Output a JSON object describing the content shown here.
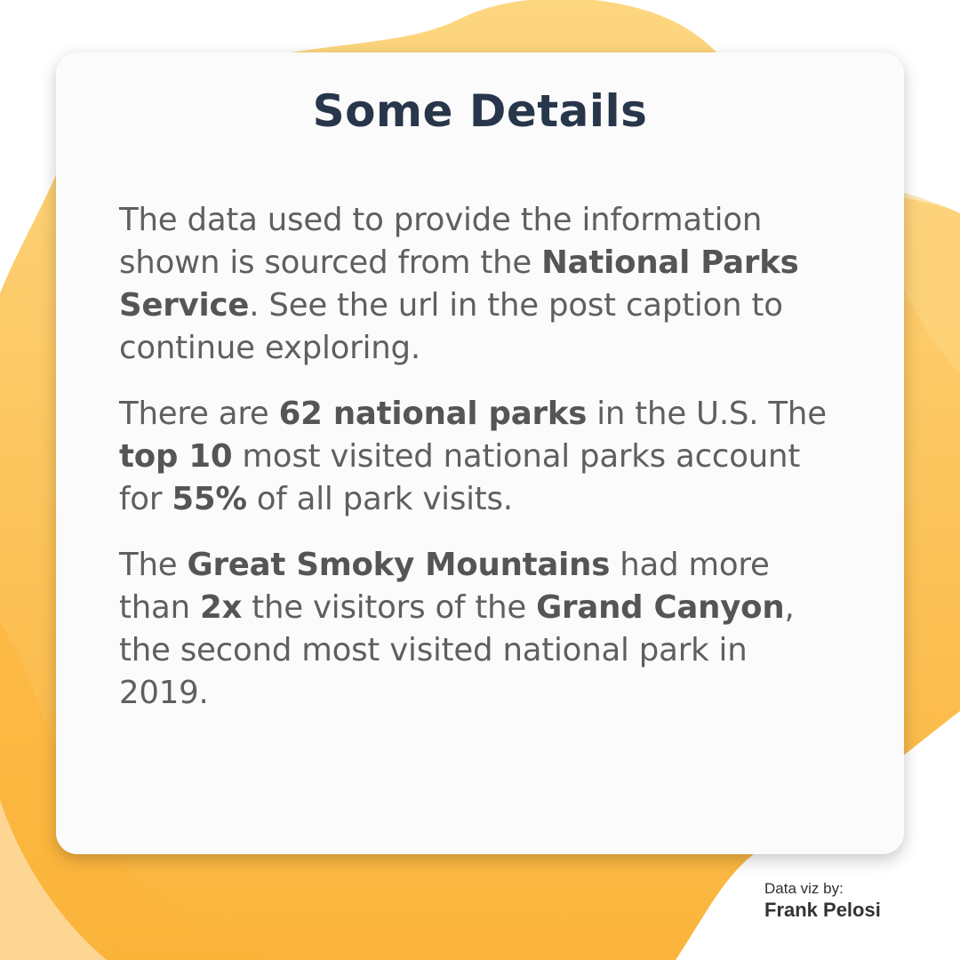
{
  "heading": "Some Details",
  "paragraphs": [
    {
      "parts": [
        {
          "text": "The data used to provide the information shown is sourced from the ",
          "bold": false
        },
        {
          "text": "National Parks Service",
          "bold": true
        },
        {
          "text": ". See the url in the post caption to continue exploring.",
          "bold": false
        }
      ]
    },
    {
      "parts": [
        {
          "text": "There are ",
          "bold": false
        },
        {
          "text": "62 national parks",
          "bold": true
        },
        {
          "text": " in the U.S. The ",
          "bold": false
        },
        {
          "text": "top 10",
          "bold": true
        },
        {
          "text": " most visited national parks account for ",
          "bold": false
        },
        {
          "text": "55%",
          "bold": true
        },
        {
          "text": " of all park visits.",
          "bold": false
        }
      ]
    },
    {
      "parts": [
        {
          "text": "The ",
          "bold": false
        },
        {
          "text": "Great Smoky Mountains",
          "bold": true
        },
        {
          "text": " had more than ",
          "bold": false
        },
        {
          "text": "2x",
          "bold": true
        },
        {
          "text": " the visitors of the ",
          "bold": false
        },
        {
          "text": "Grand Canyon",
          "bold": true
        },
        {
          "text": ", the second most visited national park in 2019.",
          "bold": false
        }
      ]
    }
  ],
  "credit": {
    "label": "Data viz by:",
    "name": "Frank Pelosi"
  },
  "colors": {
    "blob_light": "#fdd57e",
    "blob_dark": "#fbb43a",
    "heading": "#27364a",
    "body": "#5f5f5f"
  }
}
